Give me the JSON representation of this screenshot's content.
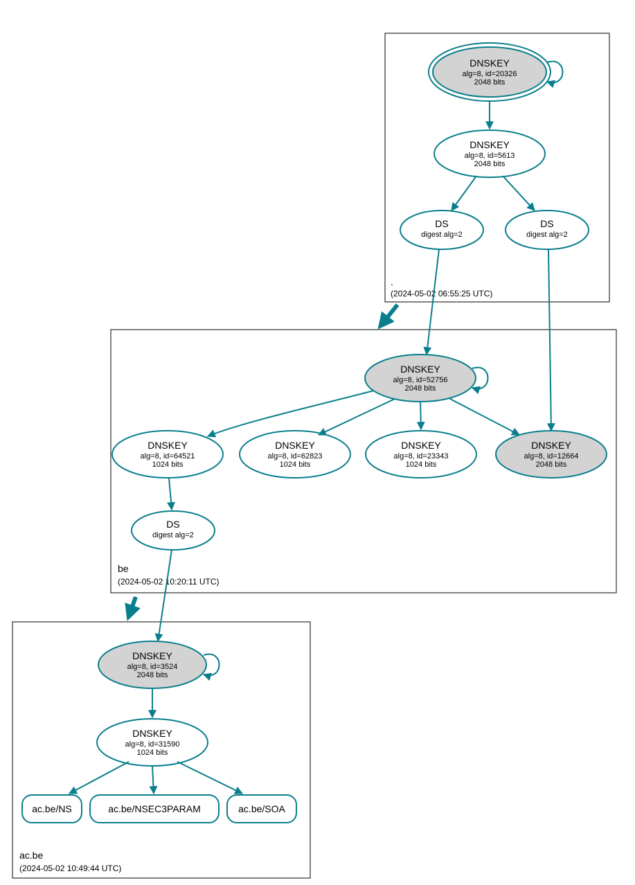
{
  "zones": {
    "root": {
      "label": ".",
      "timestamp": "(2024-05-02 06:55:25 UTC)"
    },
    "be": {
      "label": "be",
      "timestamp": "(2024-05-02 10:20:11 UTC)"
    },
    "acbe": {
      "label": "ac.be",
      "timestamp": "(2024-05-02 10:49:44 UTC)"
    }
  },
  "nodes": {
    "root_ksk": {
      "title": "DNSKEY",
      "l2": "alg=8, id=20326",
      "l3": "2048 bits"
    },
    "root_zsk": {
      "title": "DNSKEY",
      "l2": "alg=8, id=5613",
      "l3": "2048 bits"
    },
    "root_ds1": {
      "title": "DS",
      "l2": "digest alg=2"
    },
    "root_ds2": {
      "title": "DS",
      "l2": "digest alg=2"
    },
    "be_ksk": {
      "title": "DNSKEY",
      "l2": "alg=8, id=52756",
      "l3": "2048 bits"
    },
    "be_k1": {
      "title": "DNSKEY",
      "l2": "alg=8, id=64521",
      "l3": "1024 bits"
    },
    "be_k2": {
      "title": "DNSKEY",
      "l2": "alg=8, id=62823",
      "l3": "1024 bits"
    },
    "be_k3": {
      "title": "DNSKEY",
      "l2": "alg=8, id=23343",
      "l3": "1024 bits"
    },
    "be_k4": {
      "title": "DNSKEY",
      "l2": "alg=8, id=12664",
      "l3": "2048 bits"
    },
    "be_ds": {
      "title": "DS",
      "l2": "digest alg=2"
    },
    "ac_ksk": {
      "title": "DNSKEY",
      "l2": "alg=8, id=3524",
      "l3": "2048 bits"
    },
    "ac_zsk": {
      "title": "DNSKEY",
      "l2": "alg=8, id=31590",
      "l3": "1024 bits"
    }
  },
  "rrsets": {
    "ns": "ac.be/NS",
    "nsec3": "ac.be/NSEC3PARAM",
    "soa": "ac.be/SOA"
  }
}
